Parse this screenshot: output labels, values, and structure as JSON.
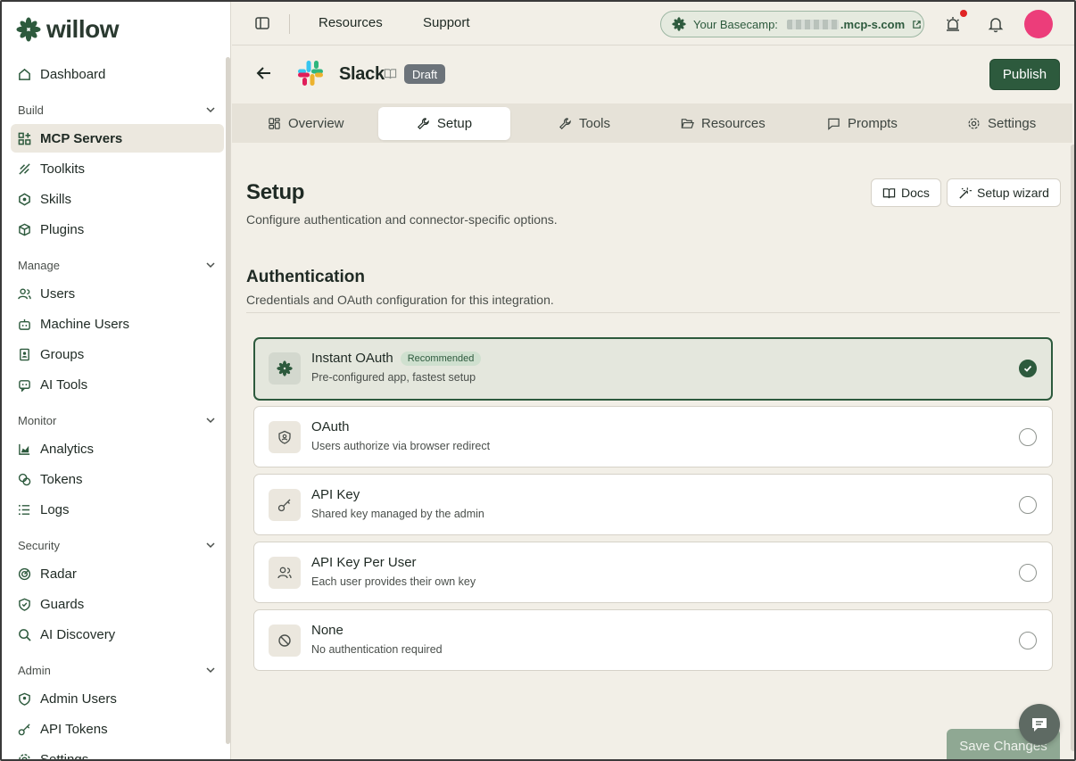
{
  "brand": {
    "name": "willow"
  },
  "sidebar": {
    "dashboard": "Dashboard",
    "sections": [
      {
        "label": "Build",
        "items": [
          "MCP Servers",
          "Toolkits",
          "Skills",
          "Plugins"
        ]
      },
      {
        "label": "Manage",
        "items": [
          "Users",
          "Machine Users",
          "Groups",
          "AI Tools"
        ]
      },
      {
        "label": "Monitor",
        "items": [
          "Analytics",
          "Tokens",
          "Logs"
        ]
      },
      {
        "label": "Security",
        "items": [
          "Radar",
          "Guards",
          "AI Discovery"
        ]
      },
      {
        "label": "Admin",
        "items": [
          "Admin Users",
          "API Tokens",
          "Settings"
        ]
      }
    ],
    "active_item": "MCP Servers"
  },
  "topbar": {
    "links": [
      "Resources",
      "Support"
    ],
    "basecamp_label": "Your Basecamp:",
    "basecamp_domain": ".mcp-s.com"
  },
  "header": {
    "title": "Slack",
    "status_badge": "Draft",
    "publish_label": "Publish"
  },
  "tabs": [
    {
      "label": "Overview"
    },
    {
      "label": "Setup"
    },
    {
      "label": "Tools"
    },
    {
      "label": "Resources"
    },
    {
      "label": "Prompts"
    },
    {
      "label": "Settings"
    }
  ],
  "active_tab": "Setup",
  "setup": {
    "title": "Setup",
    "subtitle": "Configure authentication and connector-specific options.",
    "docs_label": "Docs",
    "wizard_label": "Setup wizard"
  },
  "auth": {
    "title": "Authentication",
    "subtitle": "Credentials and OAuth configuration for this integration.",
    "options": [
      {
        "title": "Instant OAuth",
        "badge": "Recommended",
        "desc": "Pre-configured app, fastest setup",
        "selected": true
      },
      {
        "title": "OAuth",
        "desc": "Users authorize via browser redirect",
        "selected": false
      },
      {
        "title": "API Key",
        "desc": "Shared key managed by the admin",
        "selected": false
      },
      {
        "title": "API Key Per User",
        "desc": "Each user provides their own key",
        "selected": false
      },
      {
        "title": "None",
        "desc": "No authentication required",
        "selected": false
      }
    ]
  },
  "footer": {
    "save_label": "Save Changes"
  },
  "colors": {
    "brand_green": "#2d5a3d",
    "avatar": "#ec3d7a",
    "notification_dot": "#e02424"
  }
}
